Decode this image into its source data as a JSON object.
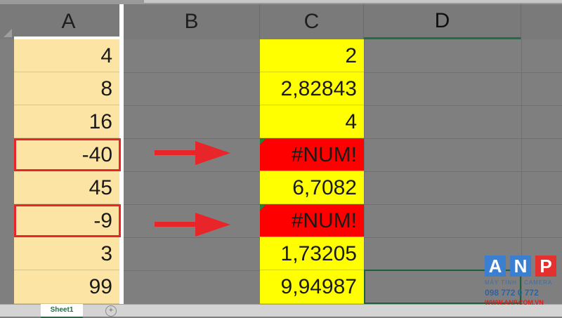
{
  "columns": {
    "a": "A",
    "b": "B",
    "c": "C",
    "d": "D"
  },
  "col_a_values": [
    "4",
    "8",
    "16",
    "-40",
    "45",
    "-9",
    "3",
    "99"
  ],
  "col_c_values": [
    "2",
    "2,82843",
    "4",
    "#NUM!",
    "6,7082",
    "#NUM!",
    "1,73205",
    "9,94987"
  ],
  "col_c_status": [
    "ok",
    "ok",
    "ok",
    "err",
    "ok",
    "err",
    "ok",
    "ok"
  ],
  "sheet_tab": "Sheet1",
  "add_sheet_symbol": "+",
  "colors": {
    "col_a_fill": "#fce4a5",
    "col_c_ok_fill": "#ffff00",
    "col_c_error_fill": "#ff0000",
    "highlight": "#e8262a",
    "selection": "#1f6f43"
  },
  "logo": {
    "letters": [
      "A",
      "N",
      "P"
    ],
    "tagline": "MÁY TÍNH - CAMERA",
    "phone": "098 772 0 772",
    "url": "WWW.ANP.COM.VN"
  }
}
